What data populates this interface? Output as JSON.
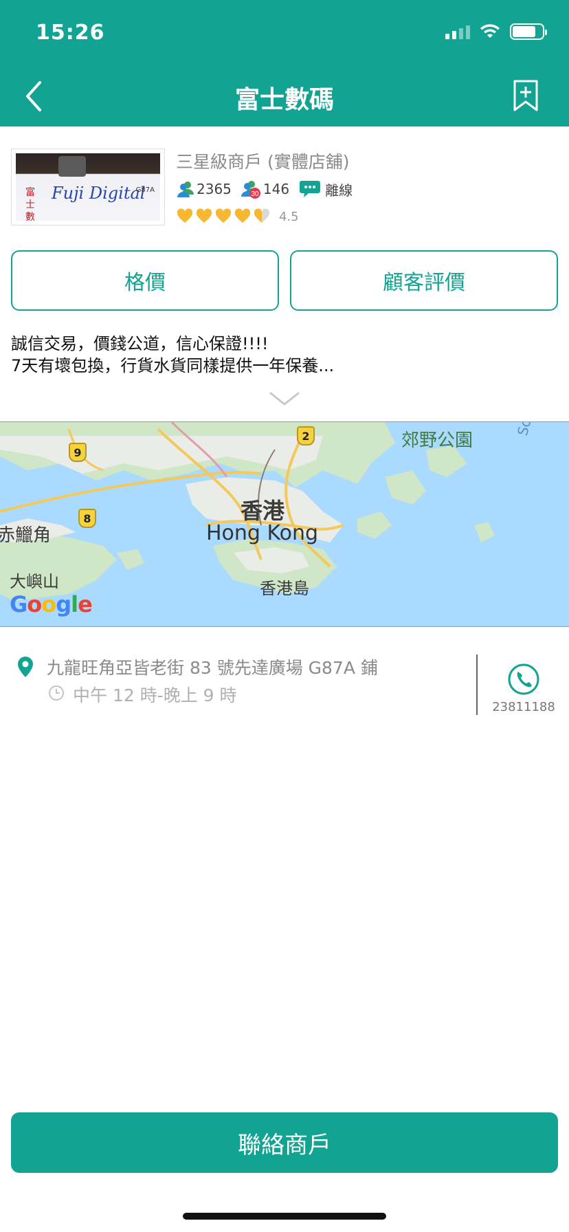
{
  "status_bar": {
    "time": "15:26"
  },
  "header": {
    "title": "富士數碼",
    "back_icon": "chevron-left-icon",
    "bookmark_icon": "bookmark-add-icon"
  },
  "merchant": {
    "thumbnail_text": "Fuji Digital",
    "thumbnail_cjk": "富士數碼",
    "thumbnail_code": "G87A",
    "type": "三星級商戶 (實體店舖)",
    "followers": "2365",
    "recent_visitors_badge": "30",
    "recent_visitors": "146",
    "chat_status": "離線",
    "rating_value": "4.5",
    "rating": 4.5,
    "rating_max": 5
  },
  "buttons": {
    "price": "格價",
    "reviews": "顧客評價",
    "contact": "聯絡商戶"
  },
  "description": {
    "line1": "誠信交易，價錢公道，信心保證!!!!",
    "line2": "7天有壞包換，行貨水貨同樣提供一年保養..."
  },
  "map": {
    "labels": {
      "hk_cjk": "香港",
      "hk_en": "Hong Kong",
      "hk_island": "香港島",
      "lantau": "大嶼山",
      "chek_lap_kok": "赤鱲角",
      "country_park": "郊野公園",
      "south": "South"
    },
    "route_shields": [
      "9",
      "8",
      "2"
    ],
    "attribution": {
      "g1": "G",
      "o1": "o",
      "o2": "o",
      "g2": "g",
      "l": "l",
      "e": "e"
    }
  },
  "contact": {
    "address": "九龍旺角亞皆老街 83 號先達廣場 G87A 鋪",
    "hours": "中午 12 時-晚上 9 時",
    "phone": "23811188"
  },
  "colors": {
    "brand": "#12a393",
    "heart": "#f7b731"
  }
}
